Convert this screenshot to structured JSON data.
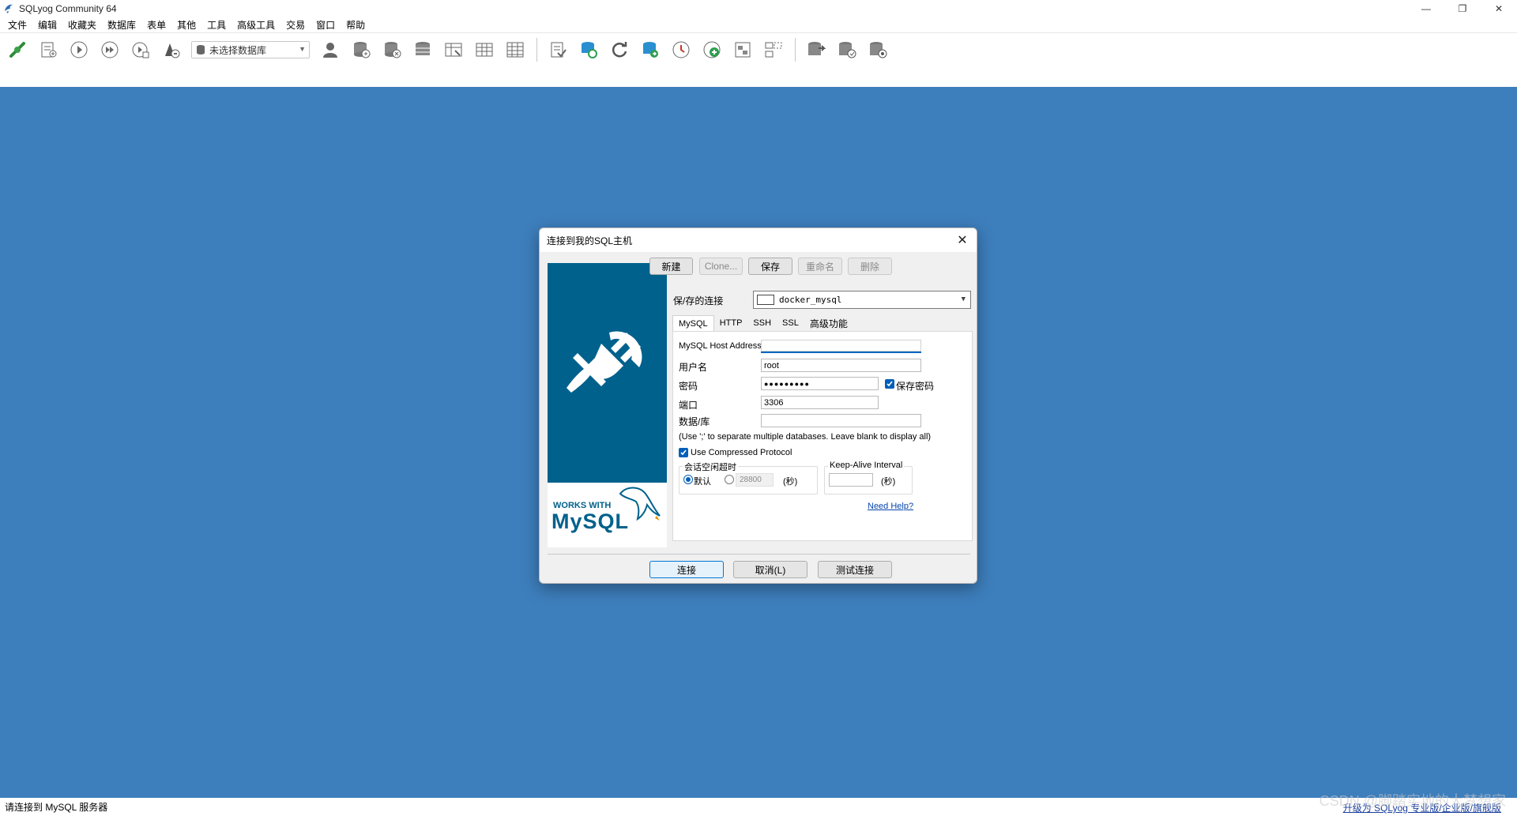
{
  "window": {
    "title": "SQLyog Community 64",
    "controls": {
      "minimize": "—",
      "restore": "❐",
      "close": "✕"
    }
  },
  "menu": [
    "文件",
    "编辑",
    "收藏夹",
    "数据库",
    "表单",
    "其他",
    "工具",
    "高级工具",
    "交易",
    "窗口",
    "帮助"
  ],
  "toolbar": {
    "db_select_placeholder": "未选择数据库",
    "icons_group1": [
      "new-connection-icon",
      "new-query-icon",
      "execute-query-icon",
      "execute-all-icon",
      "execute-edit-icon",
      "stop-icon"
    ],
    "icons_group2": [
      "user-manager-icon",
      "db-add-icon",
      "db-remove-icon",
      "db-stack-icon",
      "table-design-icon",
      "table-grid-icon",
      "table-data-icon"
    ],
    "icons_group3": [
      "export-icon",
      "db-sync-icon",
      "refresh-icon",
      "db-import-icon",
      "scheduler-icon",
      "add-job-icon",
      "schema-icon",
      "struct-icon"
    ],
    "icons_group4": [
      "backup-icon",
      "restore-icon",
      "db-settings-icon"
    ]
  },
  "dialog": {
    "title": "连接到我的SQL主机",
    "buttons": {
      "new": "新建",
      "clone": "Clone...",
      "save": "保存",
      "rename": "重命名",
      "delete": "删除"
    },
    "saved_label": "保/存的连接",
    "saved_value": "docker_mysql",
    "tabs": [
      "MySQL",
      "HTTP",
      "SSH",
      "SSL",
      "高级功能"
    ],
    "active_tab": "MySQL",
    "fields": {
      "host_label": "MySQL Host Address",
      "host_value": "",
      "user_label": "用户名",
      "user_value": "root",
      "password_label": "密码",
      "password_value": "●●●●●●●●●",
      "save_password_label": "保存密码",
      "save_password_checked": true,
      "port_label": "端口",
      "port_value": "3306",
      "db_label": "数据/库",
      "db_value": "",
      "db_hint": "(Use ';' to separate multiple databases. Leave blank to display all)"
    },
    "compressed_label": "Use Compressed Protocol",
    "compressed_checked": true,
    "session_timeout": {
      "title": "会话空闲超时",
      "default_label": "默认",
      "custom_value": "28800",
      "unit": "(秒)"
    },
    "keepalive": {
      "title": "Keep-Alive Interval",
      "value": "",
      "unit": "(秒)"
    },
    "need_help": "Need Help?",
    "footer": {
      "connect": "连接",
      "cancel": "取消(L)",
      "test": "测试连接"
    },
    "side": {
      "works_with": "WORKS WITH",
      "mysql": "MySQL"
    }
  },
  "status": {
    "text": "请连接到 MySQL 服务器",
    "upgrade": "升级为 SQLyog 专业版/企业版/旗舰版",
    "watermark": "CSDN @脚踏实地的大梦想家"
  },
  "colors": {
    "workspace": "#3d7ebc",
    "side_panel": "#00618c",
    "accent": "#005fb8"
  }
}
